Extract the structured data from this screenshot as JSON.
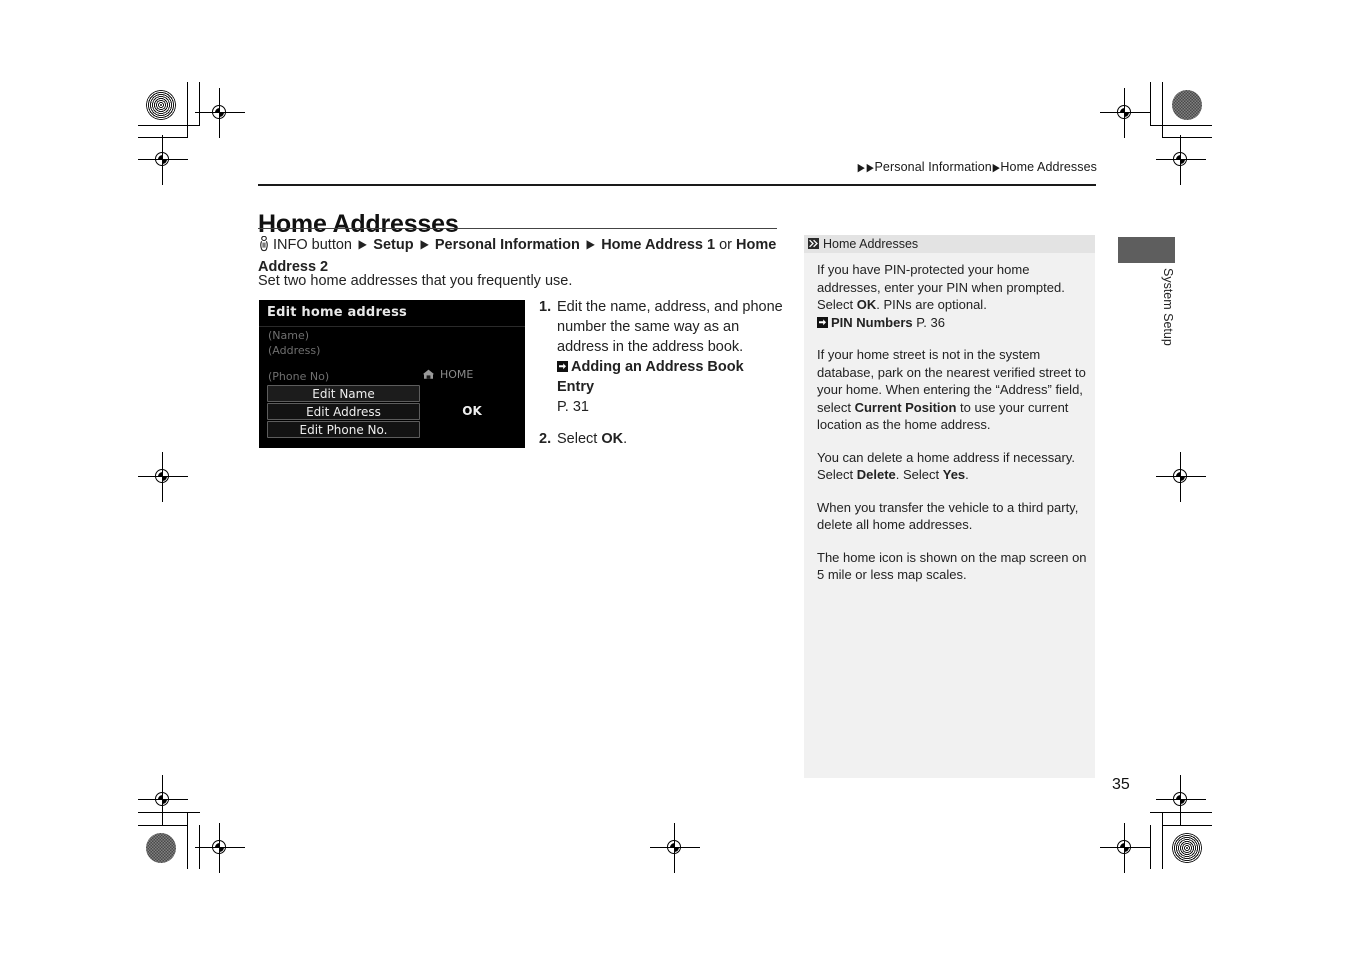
{
  "breadcrumb": {
    "arrow": "▶",
    "section": "Personal Information",
    "topic": "Home Addresses"
  },
  "page": {
    "title": "Home Addresses",
    "number": "35",
    "intro": "Set two home addresses that you frequently use."
  },
  "navpath": {
    "icon": "hand-press-icon",
    "button": "INFO button",
    "arrow": "▶",
    "item1": "Setup",
    "item2": "Personal Information",
    "item3": "Home Address 1",
    "conjunction": "or",
    "item4": "Home Address 2"
  },
  "navshot": {
    "title": "Edit home address",
    "field_name": "(Name)",
    "field_address": "(Address)",
    "field_phone": "(Phone No)",
    "home_label": "HOME",
    "home_icon": "house-icon",
    "btn_edit_name": "Edit Name",
    "btn_edit_address": "Edit Address",
    "btn_edit_phone": "Edit Phone No.",
    "btn_ok": "OK"
  },
  "steps": [
    {
      "num": "1.",
      "text": "Edit the name, address, and phone number the same way as an address in the address book.",
      "xref_icon": "jump-arrow-icon",
      "xref_label": "Adding an Address Book Entry",
      "xref_page": "P. 31"
    },
    {
      "num": "2.",
      "text_pre": "Select ",
      "text_bold": "OK",
      "text_post": "."
    }
  ],
  "sidebar": {
    "icon": "double-chevron-icon",
    "heading": "Home Addresses",
    "paragraphs": [
      {
        "id": "pin",
        "lead": "If you have PIN-protected your home addresses, enter your PIN when prompted. Select ",
        "bold1": "OK",
        "mid": ". PINs are optional.",
        "xref_icon": "jump-arrow-icon",
        "xref_label": "PIN Numbers",
        "xref_page": "P. 36"
      },
      {
        "id": "street",
        "lead": "If your home street is not in the system database, park on the nearest verified street to your home. When entering the “Address” field, select ",
        "bold1": "Current Position",
        "mid": " to use your current location as the home address."
      },
      {
        "id": "delete",
        "lead": "You can delete a home address if necessary. Select ",
        "bold1": "Delete",
        "mid": ". Select ",
        "bold2": "Yes",
        "tail": "."
      },
      {
        "id": "transfer",
        "lead": "When you transfer the vehicle to a third party, delete all home addresses."
      },
      {
        "id": "mapicon",
        "lead": "The home icon is shown on the map screen on 5 mile or less map scales."
      }
    ]
  },
  "side_tab": {
    "label": "System Setup",
    "color": "#5e5e5e"
  }
}
